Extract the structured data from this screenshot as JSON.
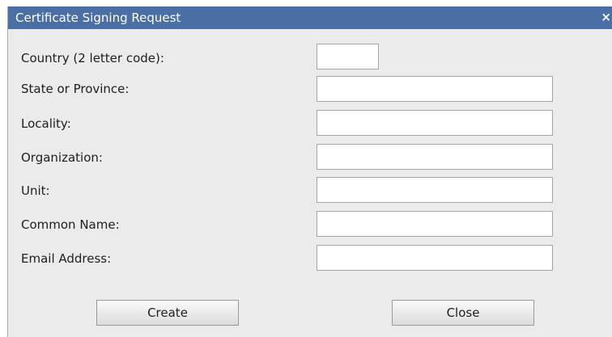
{
  "dialog": {
    "title": "Certificate Signing Request",
    "close_label": "×"
  },
  "fields": [
    {
      "label": "Country (2 letter code):",
      "value": ""
    },
    {
      "label": "State or Province:",
      "value": ""
    },
    {
      "label": "Locality:",
      "value": ""
    },
    {
      "label": "Organization:",
      "value": ""
    },
    {
      "label": "Unit:",
      "value": ""
    },
    {
      "label": "Common Name:",
      "value": ""
    },
    {
      "label": "Email Address:",
      "value": ""
    }
  ],
  "buttons": {
    "create_label": "Create",
    "close_label": "Close"
  },
  "colors": {
    "titlebar": "#4a6fa5",
    "dialog_background": "#ebebeb"
  }
}
